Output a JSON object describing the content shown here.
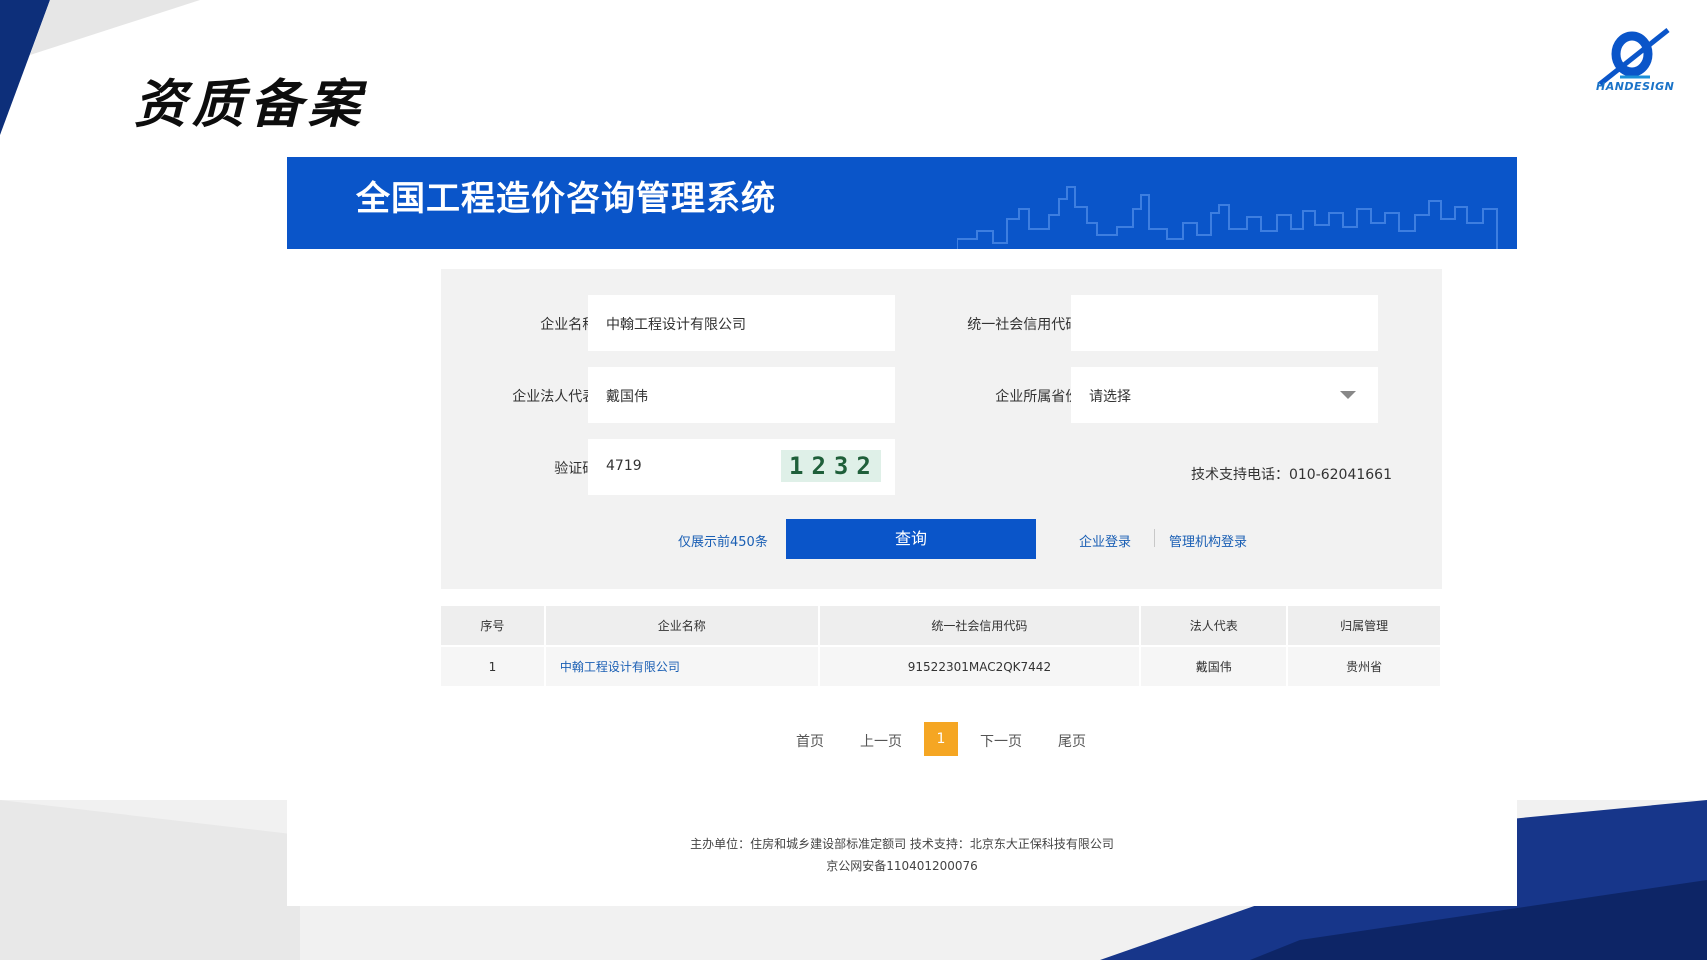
{
  "slide": {
    "title": "资质备案",
    "logo_text": "HANDESIGN",
    "brand_color": "#0a55c9",
    "logo_icon": "stylized-q-logo-icon"
  },
  "app": {
    "title": "全国工程造价咨询管理系统",
    "skyline_icon": "city-skyline-icon"
  },
  "form": {
    "company_name_label": "企业名称:",
    "company_name_value": "中翰工程设计有限公司",
    "credit_code_label": "统一社会信用代码:",
    "credit_code_value": "",
    "legal_rep_label": "企业法人代表:",
    "legal_rep_value": "戴国伟",
    "province_label": "企业所属省份:",
    "province_value": "请选择",
    "captcha_label": "验证码:",
    "captcha_input_value": "4719",
    "captcha_image_text": "1232",
    "support_phone": "技术支持电话：010-62041661",
    "limit_note": "仅展示前450条",
    "query_button": "查询",
    "company_login": "企业登录",
    "agency_login": "管理机构登录"
  },
  "table": {
    "headers": [
      "序号",
      "企业名称",
      "统一社会信用代码",
      "法人代表",
      "归属管理"
    ],
    "rows": [
      [
        "1",
        "中翰工程设计有限公司",
        "91522301MAC2QK7442",
        "戴国伟",
        "贵州省"
      ]
    ]
  },
  "pagination": {
    "first": "首页",
    "prev": "上一页",
    "current": "1",
    "next": "下一页",
    "last": "尾页",
    "current_color": "#f5a623"
  },
  "footer": {
    "line1": "主办单位：住房和城乡建设部标准定额司 技术支持：北京东大正保科技有限公司",
    "line2": "京公网安备110401200076"
  }
}
